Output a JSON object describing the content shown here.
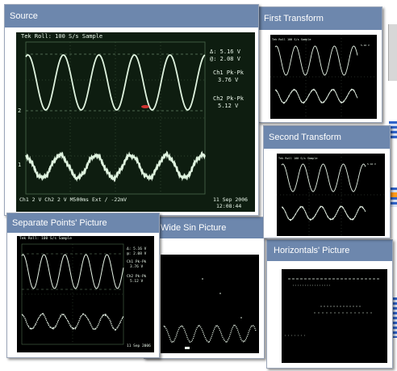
{
  "panels": [
    {
      "id": "source",
      "title": "Source",
      "scope": {
        "header": "Tek Roll: 100 S/s    Sample",
        "readouts": [
          "Δ: 5.16 V",
          "@: 2.08 V",
          "Ch1 Pk-Pk",
          "3.76 V",
          "Ch2 Pk-Pk",
          "5.12 V"
        ],
        "footer": "Ch1    2 V    Ch2    2 V    M500ms  Ext  ∕  -22mV",
        "date": "11 Sep 2006",
        "time": "12:08:44"
      }
    },
    {
      "id": "first",
      "title": "First Transform"
    },
    {
      "id": "second",
      "title": "Second Transform"
    },
    {
      "id": "separate",
      "title": "Separate Points' Picture",
      "scope": {
        "header": "Tek Roll: 100 S/s    Sample",
        "readouts": [
          "Δ: 5.16 V",
          "@: 2.08 V",
          "Ch1 Pk-Pk",
          "3.76 V",
          "Ch2 Pk-Pk",
          "5.12 V"
        ],
        "date": "11 Sep 2006"
      }
    },
    {
      "id": "widesin",
      "title": "Wide Sin Picture"
    },
    {
      "id": "horizontals",
      "title": "Horizontals' Picture"
    }
  ],
  "colors": {
    "titlebar": "#6d87ad",
    "trace": "#dff3df",
    "accent": "#ff9a1a",
    "scrollbar": "#2f63c9"
  }
}
